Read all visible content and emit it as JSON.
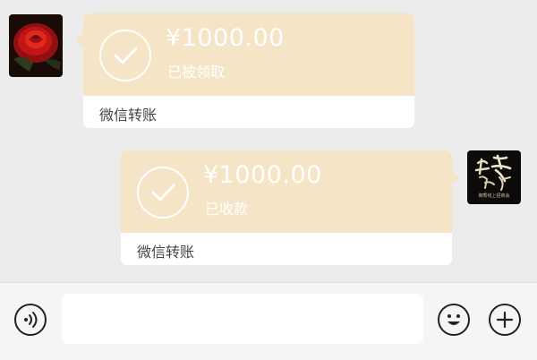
{
  "colors": {
    "background": "#ececec",
    "transfer_card": "#f6e4c6",
    "transfer_text": "#ffffff",
    "caption_text": "#454545",
    "input_bar": "#f5f5f5"
  },
  "messages": [
    {
      "side": "left",
      "type": "transfer",
      "amount": "¥1000.00",
      "status": "已被领取",
      "caption": "微信转账",
      "icon": "check-circle-icon"
    },
    {
      "side": "right",
      "type": "transfer",
      "amount": "¥1000.00",
      "status": "已收款",
      "caption": "微信转账",
      "icon": "check-circle-icon"
    }
  ],
  "avatars": {
    "left": {
      "image": "red-rose-photo"
    },
    "right": {
      "image": "calligraphy-logo",
      "text": "御秀线上招商会"
    }
  },
  "input_bar": {
    "voice_icon": "voice-icon",
    "input_value": "",
    "emoji_icon": "emoji-icon",
    "plus_icon": "plus-icon"
  }
}
